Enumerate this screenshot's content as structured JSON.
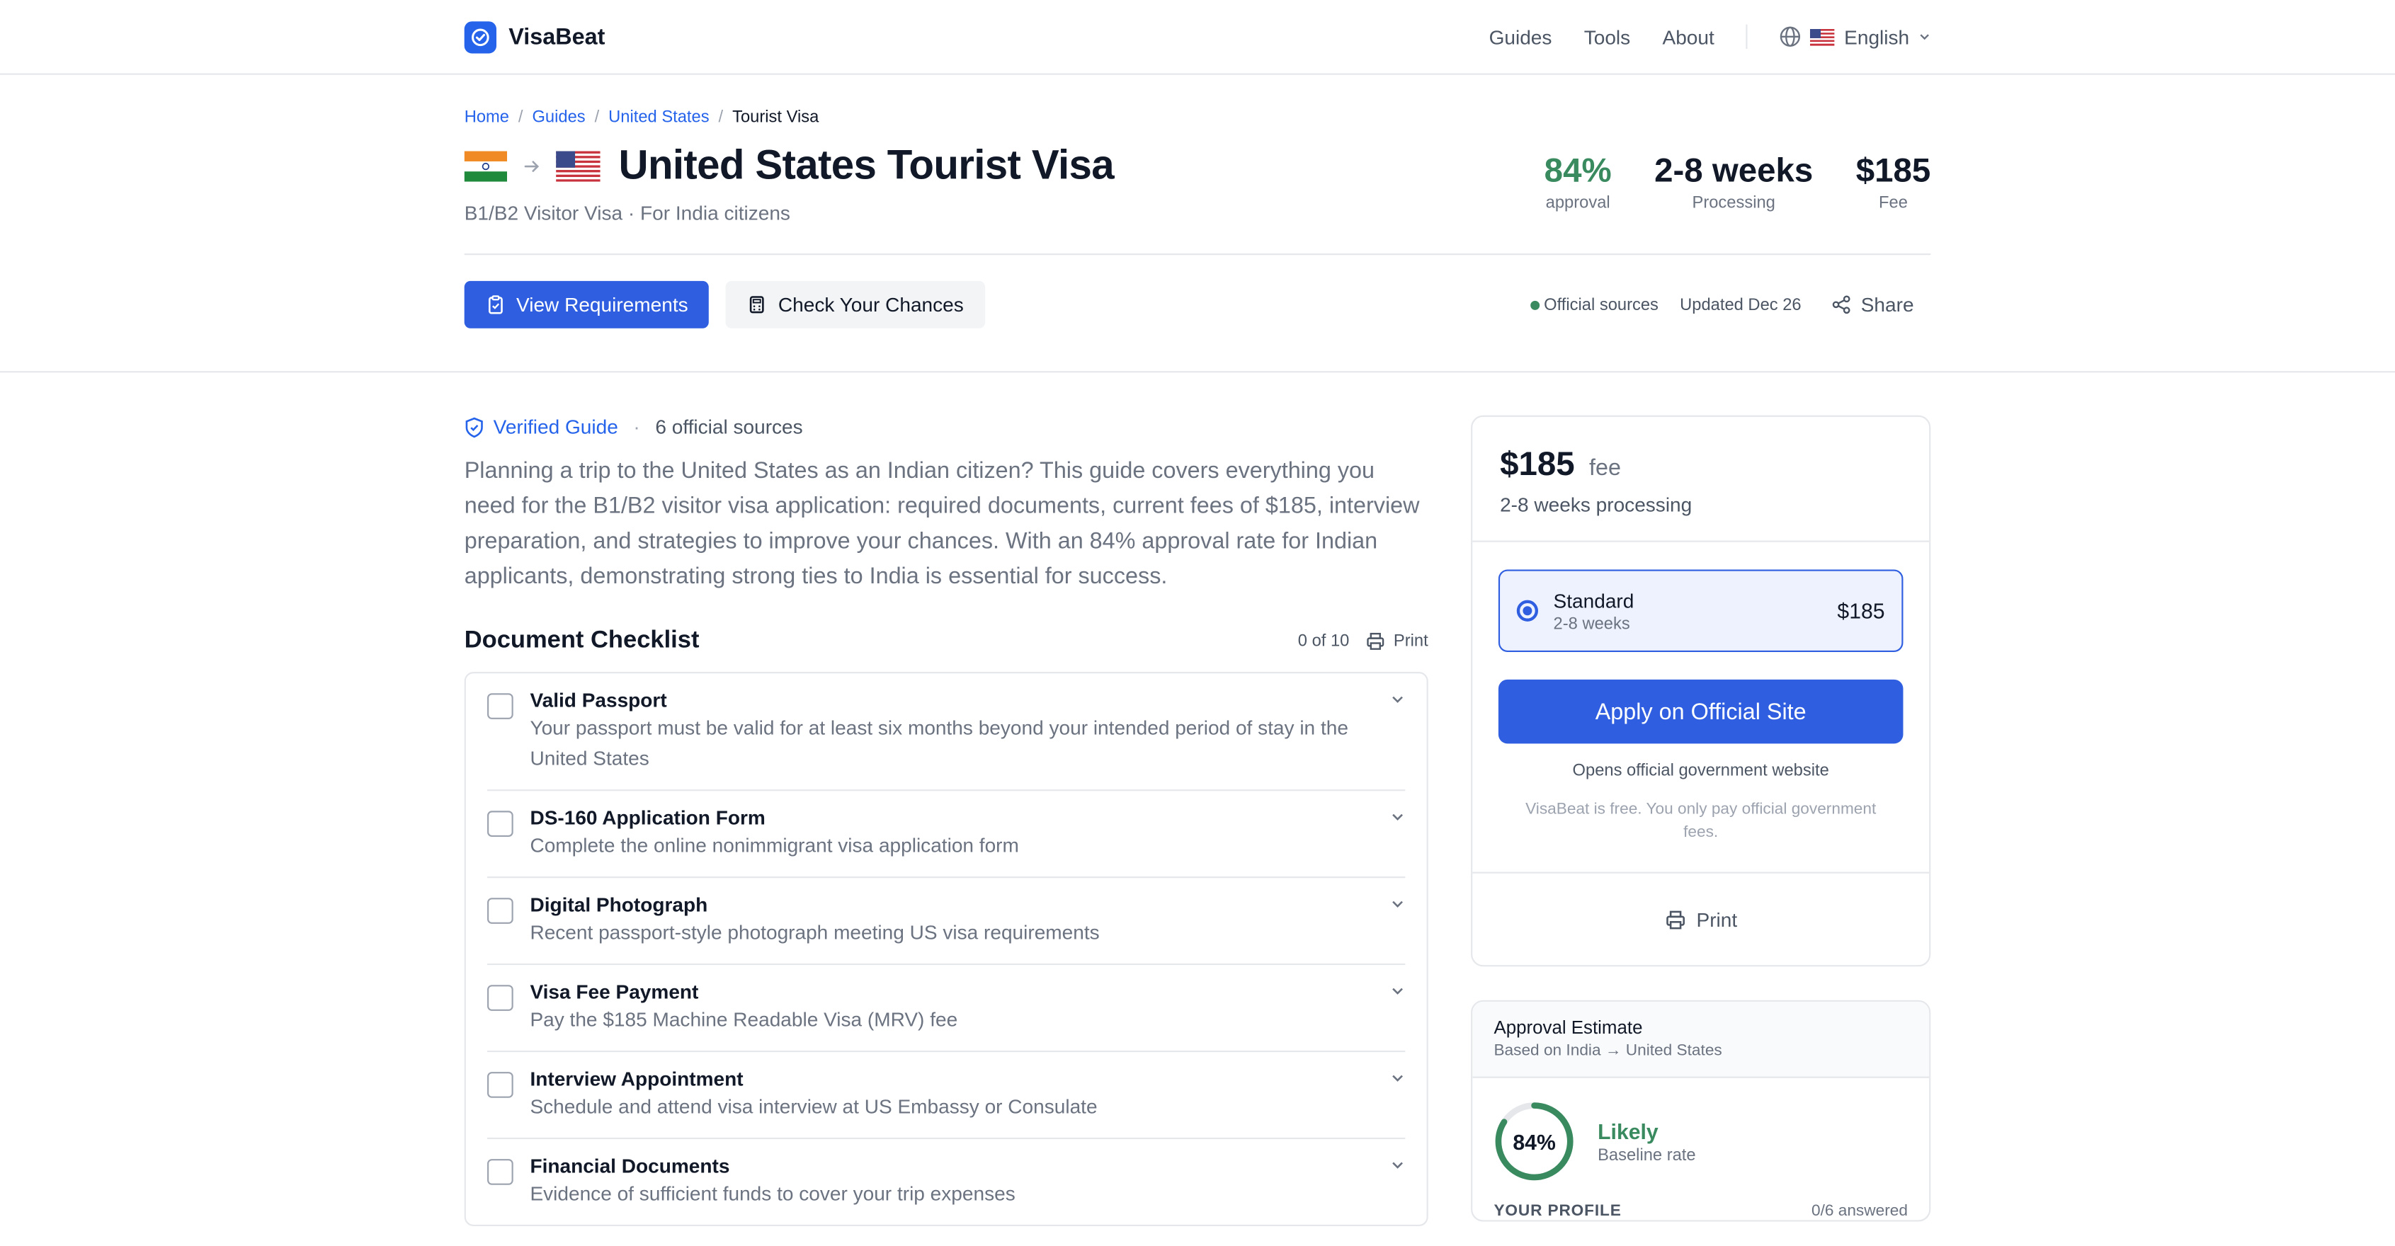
{
  "header": {
    "brand": "VisaBeat",
    "nav": [
      "Guides",
      "Tools",
      "About"
    ],
    "language": "English"
  },
  "breadcrumb": {
    "home": "Home",
    "guides": "Guides",
    "country": "United States",
    "current": "Tourist Visa"
  },
  "hero": {
    "title": "United States Tourist Visa",
    "subtitle": "B1/B2 Visitor Visa · For India citizens",
    "stats": {
      "approval_value": "84%",
      "approval_label": "approval",
      "processing_value": "2-8 weeks",
      "processing_label": "Processing",
      "fee_value": "$185",
      "fee_label": "Fee"
    },
    "actions": {
      "view_requirements": "View Requirements",
      "check_chances": "Check Your Chances"
    },
    "meta": {
      "official": "Official sources",
      "updated": "Updated Dec 26",
      "share": "Share"
    }
  },
  "guide": {
    "verified": "Verified Guide",
    "separator": "·",
    "sources": "6 official sources",
    "intro": "Planning a trip to the United States as an Indian citizen? This guide covers everything you need for the B1/B2 visitor visa application: required documents, current fees of $185, interview preparation, and strategies to improve your chances. With an 84% approval rate for Indian applicants, demonstrating strong ties to India is essential for success."
  },
  "checklist": {
    "title": "Document Checklist",
    "progress": "0 of 10",
    "print": "Print",
    "items": [
      {
        "title": "Valid Passport",
        "desc": "Your passport must be valid for at least six months beyond your intended period of stay in the United States"
      },
      {
        "title": "DS-160 Application Form",
        "desc": "Complete the online nonimmigrant visa application form"
      },
      {
        "title": "Digital Photograph",
        "desc": "Recent passport-style photograph meeting US visa requirements"
      },
      {
        "title": "Visa Fee Payment",
        "desc": "Pay the $185 Machine Readable Visa (MRV) fee"
      },
      {
        "title": "Interview Appointment",
        "desc": "Schedule and attend visa interview at US Embassy or Consulate"
      },
      {
        "title": "Financial Documents",
        "desc": "Evidence of sufficient funds to cover your trip expenses"
      }
    ]
  },
  "sidebar": {
    "fee": "$185",
    "fee_word": "fee",
    "processing": "2-8 weeks processing",
    "option": {
      "name": "Standard",
      "time": "2-8 weeks",
      "price": "$185"
    },
    "apply": "Apply on Official Site",
    "opens": "Opens official government website",
    "free_note": "VisaBeat is free. You only pay official government fees.",
    "print": "Print"
  },
  "approval": {
    "title": "Approval Estimate",
    "subtitle": "Based on India → United States",
    "percent": "84%",
    "percent_value": 84,
    "status": "Likely",
    "status_sub": "Baseline rate",
    "profile_label": "YOUR PROFILE",
    "answered": "0/6 answered"
  },
  "colors": {
    "primary": "#2f5fe0",
    "success": "#3a8a5f",
    "india_saffron": "#f08a24",
    "india_green": "#1f8a3c"
  }
}
